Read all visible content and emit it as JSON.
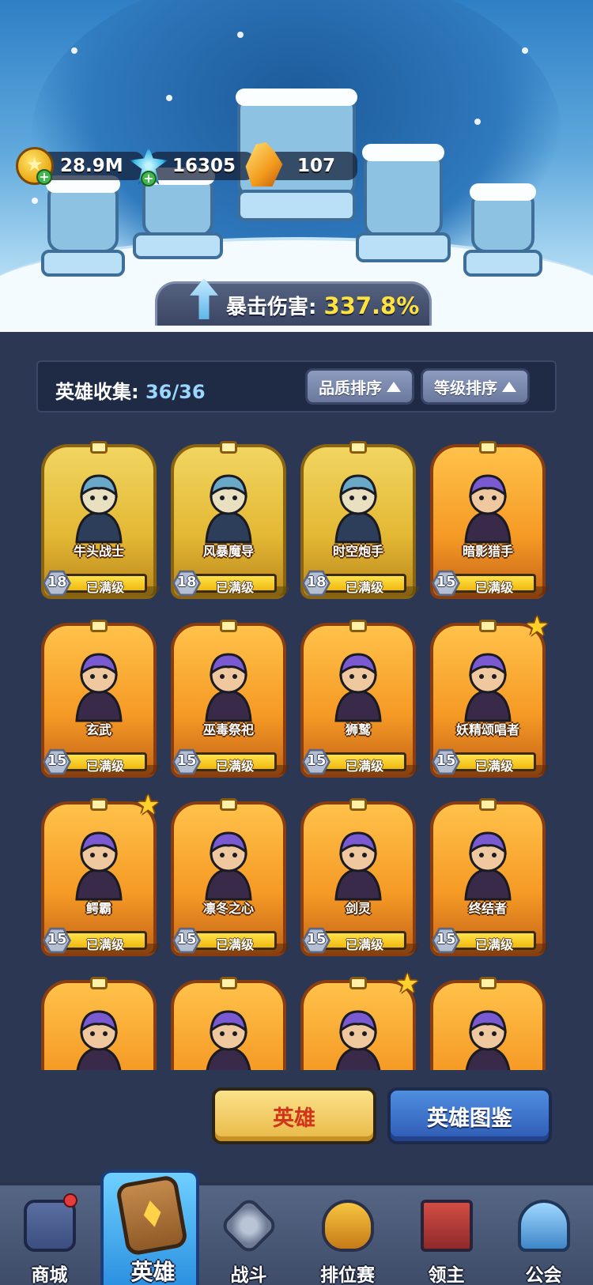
{
  "resources": {
    "gold": "28.9M",
    "ice_gem": "16305",
    "crystal": "107"
  },
  "crit": {
    "label": "暴击伤害:",
    "value": "337.8%"
  },
  "collection": {
    "label": "英雄收集:",
    "count": "36/36",
    "sort_quality": "品质排序",
    "sort_level": "等级排序"
  },
  "heroes": [
    {
      "name": "牛头战士",
      "level": "18",
      "status": "已满级",
      "rarity": "gold",
      "star": false,
      "icon": "minotaur-warrior-portrait"
    },
    {
      "name": "风暴魔导",
      "level": "18",
      "status": "已满级",
      "rarity": "gold",
      "star": false,
      "icon": "storm-mage-portrait"
    },
    {
      "name": "时空炮手",
      "level": "18",
      "status": "已满级",
      "rarity": "gold",
      "star": false,
      "icon": "time-gunner-portrait"
    },
    {
      "name": "暗影猎手",
      "level": "15",
      "status": "已满级",
      "rarity": "orange",
      "star": false,
      "icon": "shadow-hunter-portrait"
    },
    {
      "name": "玄武",
      "level": "15",
      "status": "已满级",
      "rarity": "orange",
      "star": false,
      "icon": "black-tortoise-portrait"
    },
    {
      "name": "巫毒祭祀",
      "level": "15",
      "status": "已满级",
      "rarity": "orange",
      "star": false,
      "icon": "voodoo-priestess-portrait"
    },
    {
      "name": "狮鹫",
      "level": "15",
      "status": "已满级",
      "rarity": "orange",
      "star": false,
      "icon": "griffin-portrait"
    },
    {
      "name": "妖精颂唱者",
      "level": "15",
      "status": "已满级",
      "rarity": "orange",
      "star": true,
      "icon": "fairy-singer-portrait"
    },
    {
      "name": "鳄霸",
      "level": "15",
      "status": "已满级",
      "rarity": "orange",
      "star": true,
      "icon": "bear-brawler-portrait"
    },
    {
      "name": "凛冬之心",
      "level": "15",
      "status": "已满级",
      "rarity": "orange",
      "star": false,
      "icon": "winter-heart-portrait"
    },
    {
      "name": "剑灵",
      "level": "15",
      "status": "已满级",
      "rarity": "orange",
      "star": false,
      "icon": "sword-spirit-portrait"
    },
    {
      "name": "终结者",
      "level": "15",
      "status": "已满级",
      "rarity": "orange",
      "star": false,
      "icon": "terminator-portrait"
    },
    {
      "name": "",
      "level": "",
      "status": "",
      "rarity": "orange",
      "star": false,
      "icon": "succubus-portrait"
    },
    {
      "name": "",
      "level": "",
      "status": "",
      "rarity": "orange",
      "star": false,
      "icon": "dragon-portrait"
    },
    {
      "name": "",
      "level": "",
      "status": "",
      "rarity": "orange",
      "star": true,
      "icon": "bald-gunner-portrait"
    },
    {
      "name": "",
      "level": "",
      "status": "",
      "rarity": "orange",
      "star": false,
      "icon": "ghost-king-portrait"
    }
  ],
  "buttons": {
    "hero": "英雄",
    "codex": "英雄图鉴"
  },
  "nav": [
    {
      "label": "商城",
      "icon": "shop-icon"
    },
    {
      "label": "英雄",
      "icon": "hero-card-icon"
    },
    {
      "label": "战斗",
      "icon": "battle-swords-icon"
    },
    {
      "label": "排位赛",
      "icon": "ranking-shield-icon"
    },
    {
      "label": "领主",
      "icon": "lord-banner-icon"
    },
    {
      "label": "公会",
      "icon": "guild-castle-icon"
    }
  ],
  "colors": {
    "background": "#2b3753",
    "gold_card": "#e3b834",
    "orange_card": "#f59a25",
    "crit_value": "#ffe23d",
    "active_tab": "#2a8fe0"
  }
}
